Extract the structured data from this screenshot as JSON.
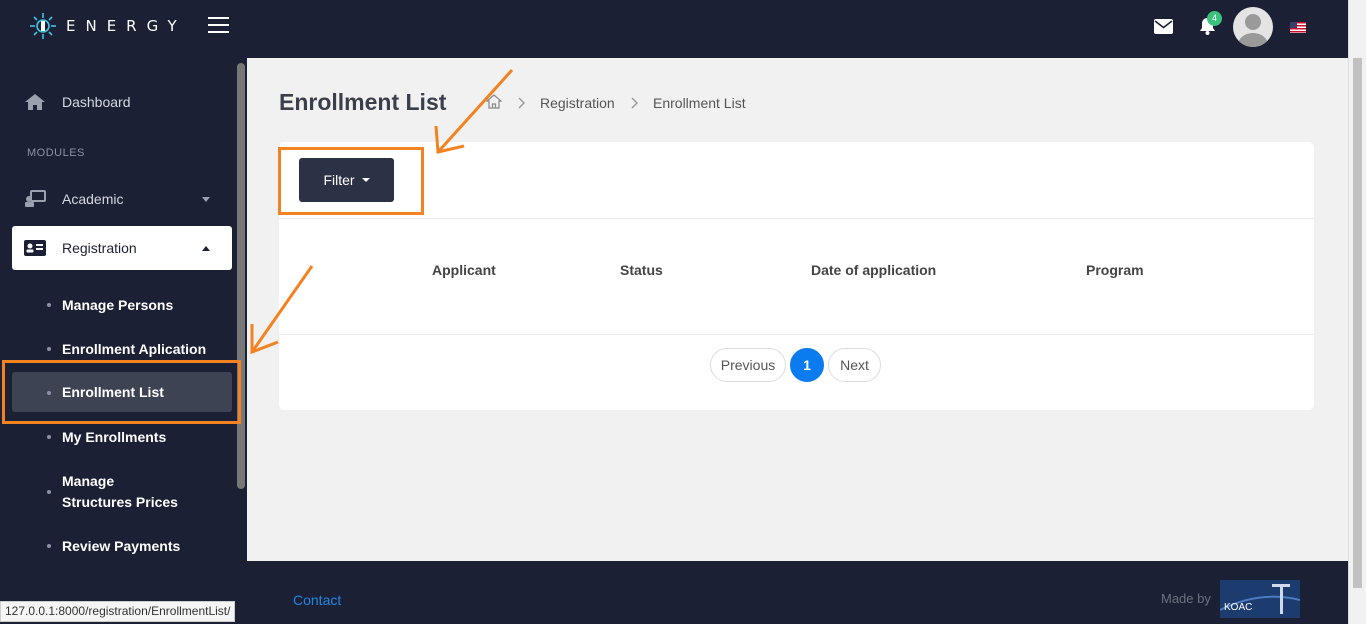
{
  "app": {
    "brand": "ENERGY"
  },
  "header": {
    "notification_count": "4",
    "icons": [
      "logo-icon",
      "hamburger-menu-icon",
      "mail-icon",
      "bell-icon",
      "avatar",
      "us-flag-icon"
    ]
  },
  "sidebar": {
    "dashboard": "Dashboard",
    "modules_heading": "MODULES",
    "academic": "Academic",
    "registration": "Registration",
    "subitems": [
      "Manage Persons",
      "Enrollment Aplication",
      "Enrollment List",
      "My Enrollments",
      "Manage Structures Prices",
      "Review Payments"
    ]
  },
  "page": {
    "title": "Enrollment List",
    "breadcrumb": [
      "Registration",
      "Enrollment List"
    ]
  },
  "filter": {
    "label": "Filter"
  },
  "table": {
    "columns": [
      "Applicant",
      "Status",
      "Date of application",
      "Program"
    ],
    "rows": []
  },
  "pagination": {
    "previous": "Previous",
    "current": "1",
    "next": "Next"
  },
  "footer": {
    "contact": "Contact",
    "made_by": "Made by",
    "made_by_logo_text": "KOAC"
  },
  "status_url": "127.0.0.1:8000/registration/EnrollmentList/",
  "colors": {
    "nav": "#1b2034",
    "highlight": "#f58220",
    "accent": "#0b7bf0"
  }
}
